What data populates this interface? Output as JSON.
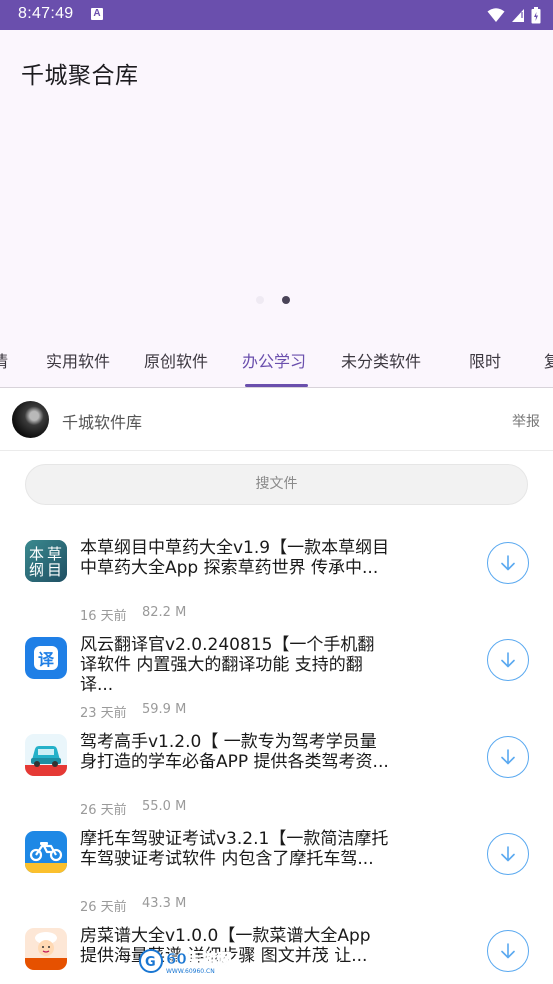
{
  "status_bar": {
    "time": "8:47:49",
    "notification_letter": "A"
  },
  "header": {
    "title": "千城聚合库"
  },
  "tabs": [
    {
      "label": "情"
    },
    {
      "label": "实用软件"
    },
    {
      "label": "原创软件"
    },
    {
      "label": "办公学习",
      "active": true
    },
    {
      "label": "未分类软件"
    },
    {
      "label": "限时"
    },
    {
      "label": "复"
    }
  ],
  "source": {
    "name": "千城软件库",
    "report_label": "举报"
  },
  "search": {
    "placeholder": "搜文件"
  },
  "files": [
    {
      "title": "本草纲目中草药大全v1.9【一款本草纲目中草药大全App 探索草药世界 传承中...",
      "age": "16 天前",
      "size": "82.2 M",
      "icon": "herbal-book-icon"
    },
    {
      "title": "风云翻译官v2.0.240815【一个手机翻译软件 内置强大的翻译功能 支持的翻译...",
      "age": "23 天前",
      "size": "59.9 M",
      "icon": "translate-icon"
    },
    {
      "title": "驾考高手v1.2.0【 一款专为驾考学员量身打造的学车必备APP 提供各类驾考资...",
      "age": "26 天前",
      "size": "55.0 M",
      "icon": "car-icon"
    },
    {
      "title": "摩托车驾驶证考试v3.2.1【一款简洁摩托车驾驶证考试软件 内包含了摩托车驾...",
      "age": "26 天前",
      "size": "43.3 M",
      "icon": "motorcycle-icon"
    },
    {
      "title": "房菜谱大全v1.0.0【一款菜谱大全App 提供海量菜谱 详细步骤 图文并茂 让...",
      "age": "",
      "size": "",
      "icon": "chef-icon"
    }
  ],
  "watermark": {
    "text": "60手游网",
    "url": "WWW.60960.CN"
  },
  "colors": {
    "status_bar": "#6a4fad",
    "accent": "#6a4fad",
    "download": "#5aa9f0"
  }
}
